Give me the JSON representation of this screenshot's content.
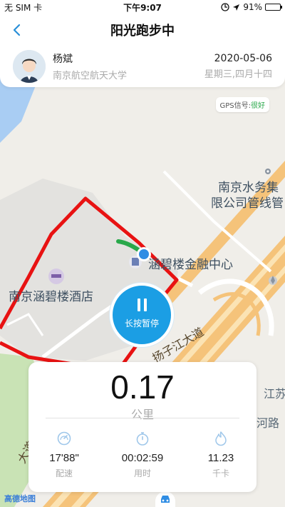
{
  "statusbar": {
    "carrier": "无 SIM 卡",
    "time": "下午9:07",
    "battery": "91%",
    "battery_level": 0.91
  },
  "navbar": {
    "title": "阳光跑步中"
  },
  "user": {
    "name": "杨斌",
    "school": "南京航空航天大学",
    "date": "2020-05-06",
    "weekday": "星期三,四月十四"
  },
  "gps": {
    "label": "GPS信号:",
    "status": "很好"
  },
  "map": {
    "labels": {
      "water1": "南京水务集",
      "water2": "限公司管线管",
      "finance": "涵碧楼金融中心",
      "hotel": "南京涵碧楼酒店",
      "road": "扬子江大道",
      "jiang": "江苏",
      "road2": "河路",
      "road3": "大道"
    },
    "route_color": "#e81212",
    "track_color": "#29a84a"
  },
  "pause_button": {
    "label": "长按暂停"
  },
  "stats": {
    "distance": "0.17",
    "distance_unit": "公里",
    "pace_value": "17'88\"",
    "pace_label": "配速",
    "time_value": "00:02:59",
    "time_label": "用时",
    "calorie_value": "11.23",
    "calorie_label": "千卡"
  },
  "map_logo": "高德地图",
  "accent_color": "#1b9ee4"
}
